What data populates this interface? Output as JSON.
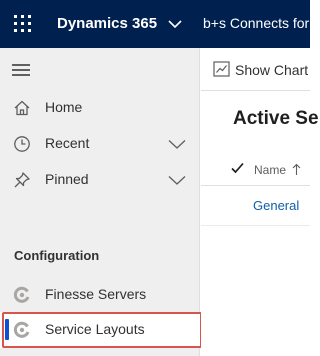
{
  "header": {
    "brand": "Dynamics 365",
    "app_name": "b+s Connects for",
    "icons": {
      "launcher": "waffle-icon",
      "brand_menu": "chevron-down-icon"
    },
    "background_color": "#002050"
  },
  "sidebar": {
    "menu_icon": "hamburger-icon",
    "items": [
      {
        "label": "Home",
        "icon": "home-icon"
      },
      {
        "label": "Recent",
        "icon": "clock-icon",
        "expandable": true
      },
      {
        "label": "Pinned",
        "icon": "pin-icon",
        "expandable": true
      }
    ],
    "section_title": "Configuration",
    "config_items": [
      {
        "label": "Finesse Servers",
        "icon": "entity-icon",
        "selected": false
      },
      {
        "label": "Service Layouts",
        "icon": "entity-icon",
        "selected": true
      }
    ],
    "accent_color": "#0f4fd1",
    "highlight_color": "#d9534f"
  },
  "main": {
    "command_bar": {
      "show_chart_label": "Show Chart",
      "icon": "chart-icon"
    },
    "view_title": "Active Se",
    "grid": {
      "columns": [
        {
          "label": "Name",
          "sort": "ascending"
        }
      ],
      "rows": [
        {
          "name": "General"
        }
      ]
    },
    "link_color": "#0f5fa8"
  }
}
